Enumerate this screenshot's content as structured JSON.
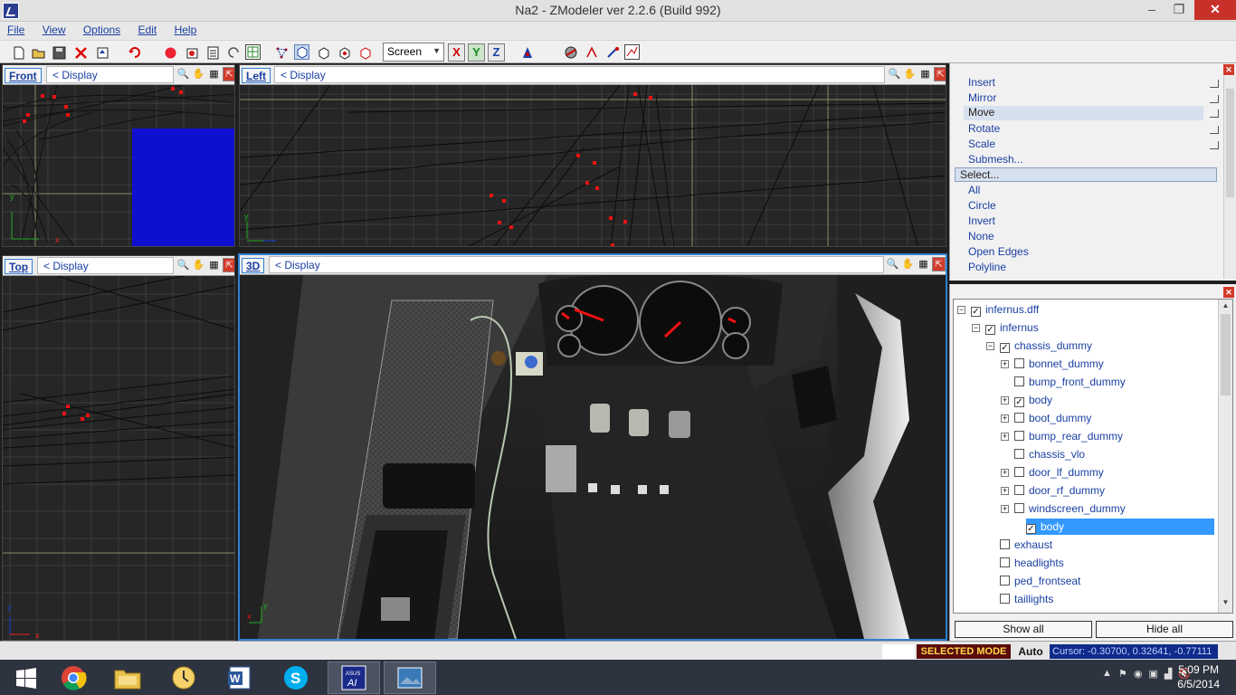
{
  "window": {
    "title": "Na2 - ZModeler ver 2.2.6 (Build 992)",
    "minimize": "–",
    "maximize": "❐",
    "close": "✕"
  },
  "menu": [
    "File",
    "View",
    "Options",
    "Edit",
    "Help"
  ],
  "toolbar": {
    "coord_mode": "Screen",
    "axis_x": "X",
    "axis_y": "Y",
    "axis_z": "Z"
  },
  "viewports": {
    "front": {
      "label": "Front",
      "display": "<  Display"
    },
    "left": {
      "label": "Left",
      "display": "<  Display"
    },
    "top": {
      "label": "Top",
      "display": "<  Display"
    },
    "view3d": {
      "label": "3D",
      "display": "<  Display"
    }
  },
  "viewport_tool_icons": [
    "zoom-icon",
    "pan-hand-icon",
    "rotate-icon",
    "maximize-viewport-icon"
  ],
  "tools_panel": {
    "items_top": [
      "Insert",
      "Mirror",
      "Move",
      "Rotate",
      "Scale",
      "Submesh..."
    ],
    "selected": "Move",
    "select_header": "Select...",
    "items_select": [
      "All",
      "Circle",
      "Invert",
      "None",
      "Open Edges",
      "Polyline"
    ]
  },
  "hierarchy": {
    "rows": [
      {
        "label": "infernus.dff",
        "checked": true,
        "expanded": true,
        "level": 0
      },
      {
        "label": "infernus",
        "checked": true,
        "expanded": true,
        "level": 1
      },
      {
        "label": "chassis_dummy",
        "checked": true,
        "expanded": true,
        "level": 2
      },
      {
        "label": "bonnet_dummy",
        "checked": false,
        "expandable": true,
        "level": 3
      },
      {
        "label": "bump_front_dummy",
        "checked": false,
        "expandable": false,
        "level": 3
      },
      {
        "label": "body",
        "checked": true,
        "expandable": true,
        "level": 3
      },
      {
        "label": "boot_dummy",
        "checked": false,
        "expandable": true,
        "level": 3
      },
      {
        "label": "bump_rear_dummy",
        "checked": false,
        "expandable": true,
        "level": 3
      },
      {
        "label": "chassis_vlo",
        "checked": false,
        "expandable": false,
        "level": 3
      },
      {
        "label": "door_lf_dummy",
        "checked": false,
        "expandable": true,
        "level": 3
      },
      {
        "label": "door_rf_dummy",
        "checked": false,
        "expandable": true,
        "level": 3
      },
      {
        "label": "windscreen_dummy",
        "checked": false,
        "expandable": true,
        "level": 3
      },
      {
        "label": "body",
        "checked": true,
        "expandable": false,
        "level": 4,
        "selected": true
      },
      {
        "label": "exhaust",
        "checked": false,
        "expandable": false,
        "level": 2
      },
      {
        "label": "headlights",
        "checked": false,
        "expandable": false,
        "level": 2
      },
      {
        "label": "ped_frontseat",
        "checked": false,
        "expandable": false,
        "level": 2
      },
      {
        "label": "taillights",
        "checked": false,
        "expandable": false,
        "level": 2
      }
    ],
    "show_all": "Show all",
    "hide_all": "Hide all"
  },
  "status": {
    "mode": "SELECTED MODE",
    "auto": "Auto",
    "cursor": "Cursor: -0.30700, 0.32641, -0.77111"
  },
  "taskbar": {
    "apps": [
      "windows-start-icon",
      "chrome-icon",
      "file-explorer-icon",
      "outlook-icon",
      "word-icon",
      "skype-icon",
      "asus-icon",
      "photos-icon"
    ],
    "clock_time": "5:09 PM",
    "clock_date": "6/5/2014"
  },
  "colors": {
    "accent": "#2f7fd3",
    "link": "#1a3fa3",
    "viewport_bg": "#262626",
    "status_mode_bg": "#5a0b0b",
    "cursor_bg": "#0f2a8a"
  }
}
